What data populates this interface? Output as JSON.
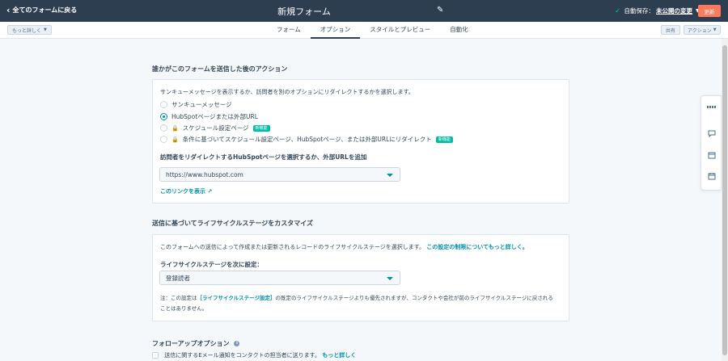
{
  "header": {
    "back_label": "全てのフォームに戻る",
    "title": "新規フォーム",
    "autosave_label": "自動保存：",
    "autosave_status": "未公開の変更",
    "update_label": "更新"
  },
  "subbar": {
    "more_label": "もっと詳しく",
    "tabs": [
      {
        "label": "フォーム"
      },
      {
        "label": "オプション"
      },
      {
        "label": "スタイルとプレビュー"
      },
      {
        "label": "自動化"
      }
    ],
    "share_label": "共有",
    "actions_label": "アクション"
  },
  "redirect_section": {
    "heading": "誰かがこのフォームを送信した後のアクション",
    "description": "サンキューメッセージを表示するか、訪問者を別のオプションにリダイレクトするかを選択します。",
    "options": [
      {
        "label": "サンキューメッセージ",
        "selected": false
      },
      {
        "label": "HubSpotページまたは外部URL",
        "selected": true
      },
      {
        "label": "スケジュール設定ページ",
        "badge": "新機能"
      },
      {
        "label": "条件に基づいてスケジュール設定ページ、HubSpotページ、または外部URLにリダイレクト",
        "badge": "新機能"
      }
    ],
    "url_field_label": "訪問者をリダイレクトするHubSpotページを選択するか、外部URLを追加",
    "url_value": "https://www.hubspot.com",
    "show_link_label": "このリンクを表示"
  },
  "lifecycle_section": {
    "heading": "送信に基づいてライフサイクルステージをカスタマイズ",
    "description": "このフォームへの送信によって作成または更新されるレコードのライフサイクルステージを選択します。",
    "limit_link": "この設定の制限についてもっと詳しく。",
    "field_label": "ライフサイクルステージを次に設定：",
    "field_value": "登録読者",
    "note_prefix": "注：この設定は",
    "note_link": "［ライフサイクルステージ設定］",
    "note_suffix_1": "の既定のライフサイクルステージよりも優先されますが、コンタクトや会社が前のライフサイクルステージに戻される",
    "note_suffix_2": "ことはありません。"
  },
  "followup_section": {
    "heading": "フォローアップオプション",
    "checkbox_label": "送信に関するEメール通知をコンタクトの担当者に送ります。",
    "checkbox_link": "もっと詳しく"
  }
}
